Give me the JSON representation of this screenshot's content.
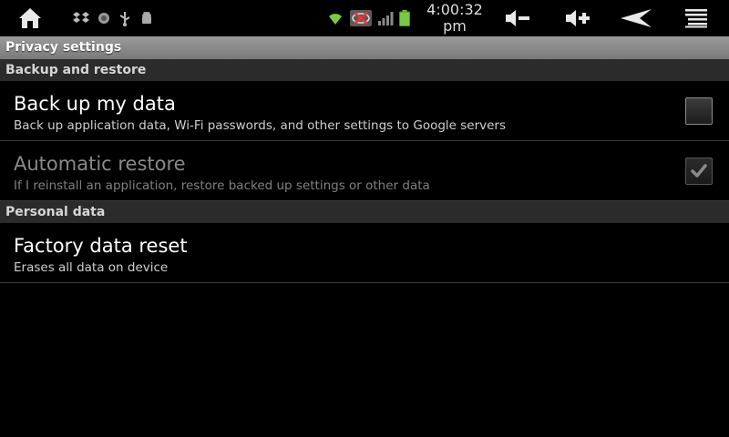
{
  "status_bar": {
    "clock_time": "4:00:32",
    "clock_ampm": "pm"
  },
  "title": "Privacy settings",
  "sections": [
    {
      "header": "Backup and restore",
      "items": [
        {
          "title": "Back up my data",
          "summary": "Back up application data, Wi-Fi passwords, and other settings to Google servers",
          "checked": false,
          "enabled": true
        },
        {
          "title": "Automatic restore",
          "summary": "If I reinstall an application, restore backed up settings or other data",
          "checked": true,
          "enabled": false
        }
      ]
    },
    {
      "header": "Personal data",
      "items": [
        {
          "title": "Factory data reset",
          "summary": "Erases all data on device"
        }
      ]
    }
  ],
  "colors": {
    "battery": "#7ac943",
    "wifi": "#7ac943",
    "title_bar": "#8a8a8a",
    "section_header": "#2b2b2b"
  }
}
